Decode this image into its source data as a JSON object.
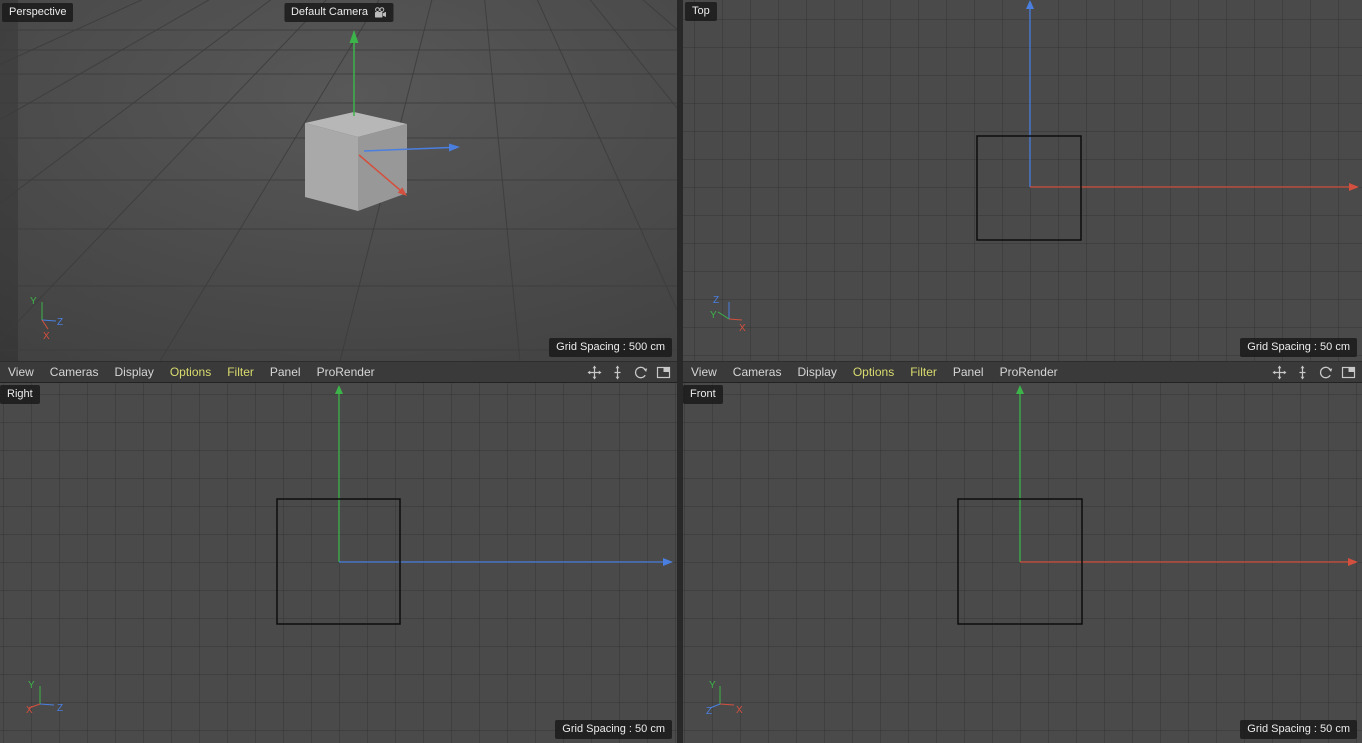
{
  "axis_labels": {
    "x": "X",
    "y": "Y",
    "z": "Z"
  },
  "viewports": {
    "perspective": {
      "label": "Perspective",
      "camera": "Default Camera",
      "grid_spacing": "Grid Spacing : 500 cm"
    },
    "top": {
      "label": "Top",
      "grid_spacing": "Grid Spacing : 50 cm"
    },
    "right": {
      "label": "Right",
      "grid_spacing": "Grid Spacing : 50 cm"
    },
    "front": {
      "label": "Front",
      "grid_spacing": "Grid Spacing : 50 cm"
    }
  },
  "toolbar": {
    "items": [
      {
        "label": "View",
        "highlighted": false
      },
      {
        "label": "Cameras",
        "highlighted": false
      },
      {
        "label": "Display",
        "highlighted": false
      },
      {
        "label": "Options",
        "highlighted": true
      },
      {
        "label": "Filter",
        "highlighted": true
      },
      {
        "label": "Panel",
        "highlighted": false
      },
      {
        "label": "ProRender",
        "highlighted": false
      }
    ],
    "icons": [
      "pan-icon",
      "dolly-icon",
      "rotate-icon",
      "toggle-layout-icon"
    ]
  },
  "colors": {
    "axis_x": "#d4503e",
    "axis_y": "#3db44a",
    "axis_z": "#4a7fe0",
    "menu_highlight": "#d9db6e"
  }
}
